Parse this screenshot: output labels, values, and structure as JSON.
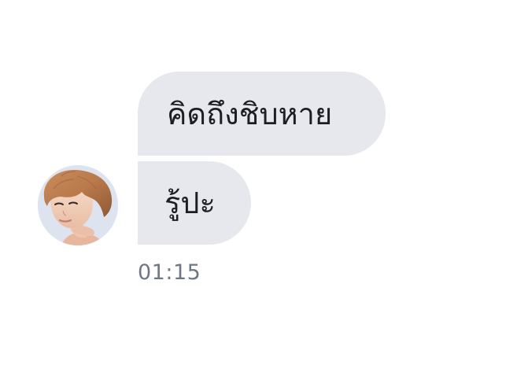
{
  "messages": [
    {
      "text": "คิดถึงชิบหาย"
    },
    {
      "text": "รู้ปะ"
    }
  ],
  "timestamp": "01:15",
  "sender": {
    "avatar_icon": "user-avatar"
  },
  "colors": {
    "bubble": "#e6e8ed",
    "text": "#1b1e22",
    "timestamp": "#6d7884",
    "background": "#ffffff"
  }
}
